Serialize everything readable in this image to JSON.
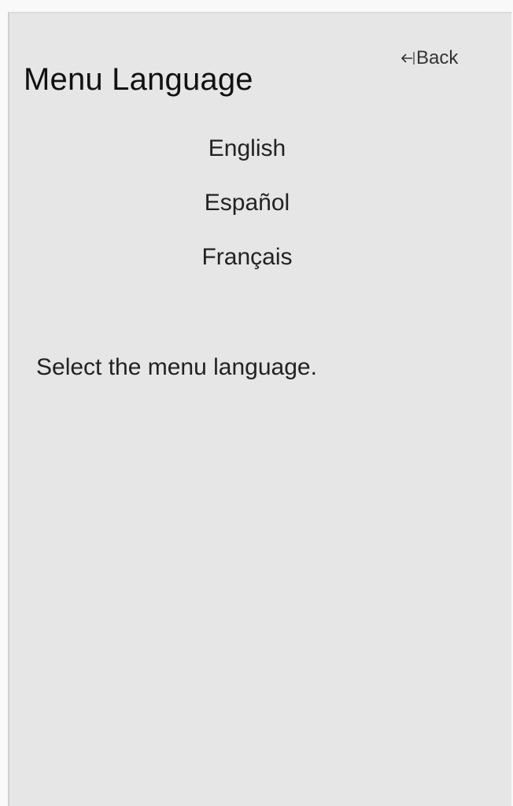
{
  "header": {
    "title": "Menu Language",
    "back_label": "Back",
    "back_icon": "arrow-left-icon"
  },
  "languages": [
    {
      "label": "English"
    },
    {
      "label": "Español"
    },
    {
      "label": "Français"
    }
  ],
  "description": "Select the menu language.",
  "colors": {
    "panel_background": "#e6e6e6",
    "page_background": "#f9f9f9",
    "text": "#222222"
  }
}
